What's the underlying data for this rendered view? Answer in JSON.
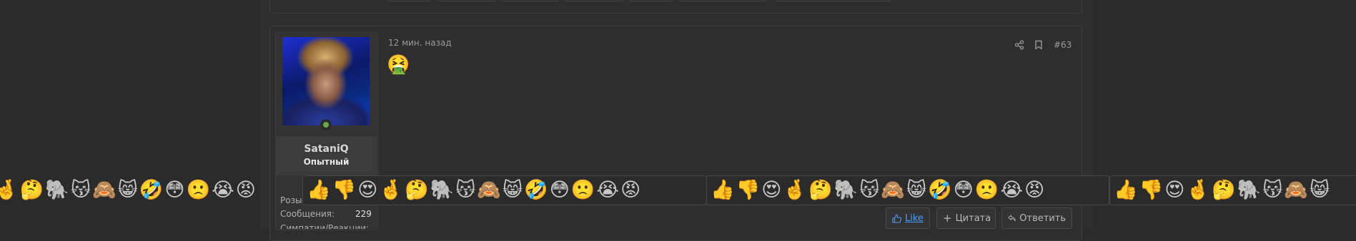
{
  "post": {
    "time": "12 мин. назад",
    "number": "#63",
    "content_emoji": "🤮"
  },
  "user": {
    "name": "SataniQ",
    "title": "Опытный",
    "stats": {
      "row_partial_label": "Розыгрыши:",
      "messages_label": "Сообщения:",
      "messages_value": "229",
      "row3_partial_label": "Симпатии/Реакции:"
    }
  },
  "actions": {
    "like_label": "Like",
    "quote_label": "Цитата",
    "reply_label": "Ответить"
  },
  "reactions_strip": {
    "left_partial": "🤞🤔🐘😽🙈😸🤣😳🙁😭😡",
    "segment_1": "👍👎😍🤞🤔🐘😽🙈😸🤣😳🙁😭😡",
    "segment_2": "👍👎😍🤞🤔🐘😽🙈😸🤣😳🙁😭😡",
    "segment_3": "👍👎😍🤞🤔🐘😽🙈😸"
  },
  "icons": {
    "share": "share-icon",
    "bookmark": "bookmark-icon",
    "like": "thumbs-up-icon",
    "quote": "plus-icon",
    "reply": "reply-arrow-icon"
  },
  "colors": {
    "background": "#2b2b2b",
    "link": "#4a9eff",
    "online": "#6aa84f"
  }
}
